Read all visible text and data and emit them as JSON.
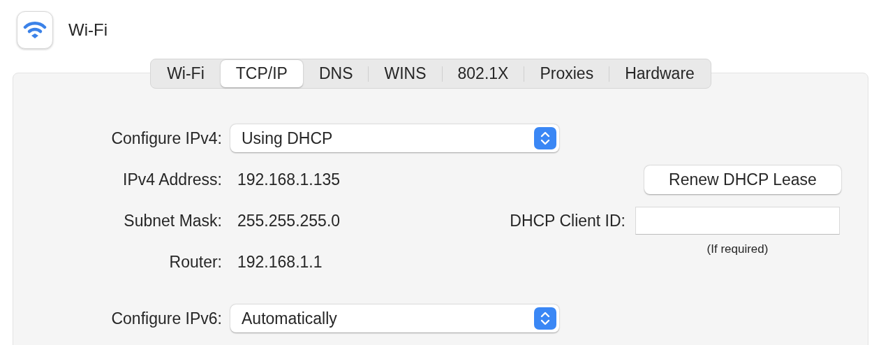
{
  "header": {
    "title": "Wi-Fi"
  },
  "tabs": [
    {
      "label": "Wi-Fi",
      "selected": false
    },
    {
      "label": "TCP/IP",
      "selected": true
    },
    {
      "label": "DNS",
      "selected": false
    },
    {
      "label": "WINS",
      "selected": false
    },
    {
      "label": "802.1X",
      "selected": false
    },
    {
      "label": "Proxies",
      "selected": false
    },
    {
      "label": "Hardware",
      "selected": false
    }
  ],
  "configure_ipv4": {
    "label": "Configure IPv4:",
    "value": "Using DHCP"
  },
  "info": [
    {
      "label": "IPv4 Address:",
      "value": "192.168.1.135"
    },
    {
      "label": "Subnet Mask:",
      "value": "255.255.255.0"
    },
    {
      "label": "Router:",
      "value": "192.168.1.1"
    }
  ],
  "renew_button": "Renew DHCP Lease",
  "client_id": {
    "label": "DHCP Client ID:",
    "note": "(If required)"
  },
  "configure_ipv6": {
    "label": "Configure IPv6:",
    "value": "Automatically"
  }
}
